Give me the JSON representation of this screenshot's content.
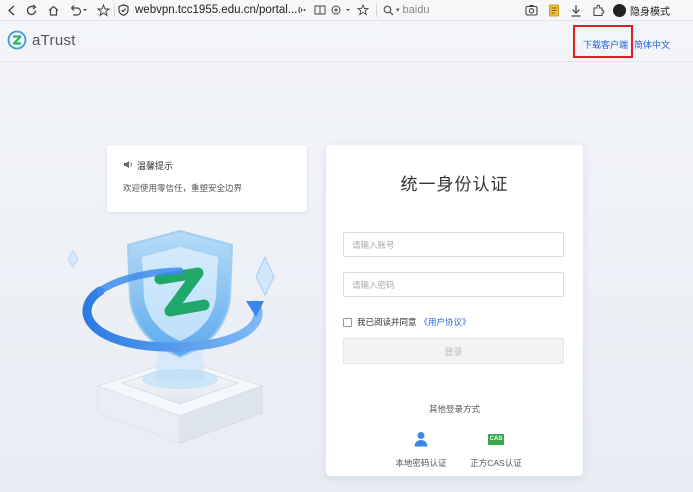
{
  "browser": {
    "url": "webvpn.tcc1955.edu.cn/portal...",
    "search_text": "baidu",
    "incognito_label": "隐身模式"
  },
  "header": {
    "logo_text": "aTrust",
    "download_client": "下载客户端",
    "language": "简体中文"
  },
  "notice": {
    "title": "温馨提示",
    "body": "欢迎使用零信任，重塑安全边界"
  },
  "login": {
    "title": "统一身份认证",
    "username_placeholder": "请输入账号",
    "password_placeholder": "请输入密码",
    "agree_text": "我已阅读并同意",
    "agree_link": "《用户协议》",
    "submit_label": "登录",
    "other_methods_title": "其他登录方式",
    "methods": [
      {
        "label": "本地密码认证",
        "icon": "user-icon"
      },
      {
        "label": "正方CAS认证",
        "icon": "cas-icon",
        "icon_text": "CAS"
      }
    ]
  },
  "colors": {
    "link_blue": "#1f66d6",
    "highlight_red": "#e02020",
    "cas_green": "#3aa74a"
  }
}
